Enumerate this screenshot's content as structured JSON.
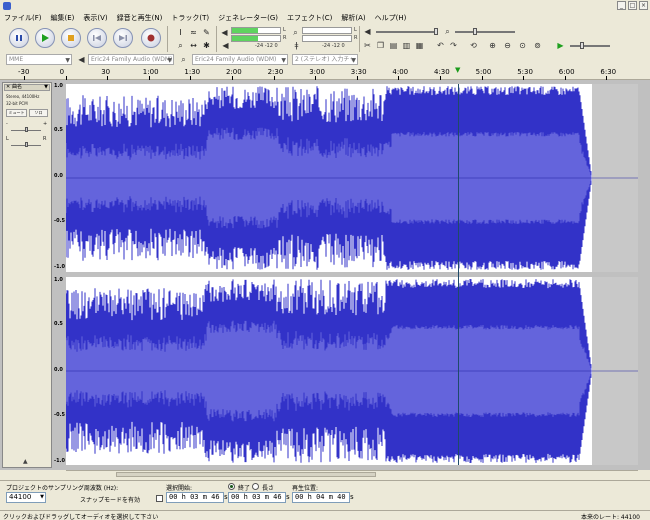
{
  "menubar": [
    "ファイル(F)",
    "編集(E)",
    "表示(V)",
    "録音と再生(N)",
    "トラック(T)",
    "ジェネレーター(G)",
    "エフェクト(C)",
    "解析(A)",
    "ヘルプ(H)"
  ],
  "window": {
    "minimize": "_",
    "maximize": "□",
    "close": "×"
  },
  "transport": [
    "pause-icon",
    "play-icon",
    "stop-icon",
    "skip-start-icon",
    "skip-end-icon",
    "record-icon"
  ],
  "meters": {
    "play_label_l": "L",
    "play_label_r": "R",
    "scale_play": "-24 -12 0",
    "scale_rec": "-24 -12 0",
    "record_label_l": "L",
    "record_label_r": "R",
    "play_level": 0.55
  },
  "devices": {
    "host": "MME",
    "output": "Eric24 Family Audio (WDM)",
    "input": "Eric24 Family Audio (WDM)",
    "channels": "2 (ステレオ) 入力チャ"
  },
  "ruler": {
    "ticks": [
      "-30",
      "0",
      "30",
      "1:00",
      "1:30",
      "2:00",
      "2:30",
      "3:00",
      "3:30",
      "4:00",
      "4:30",
      "5:00",
      "5:30",
      "6:00",
      "6:30"
    ]
  },
  "track": {
    "name": "曲名",
    "info_line1": "Stereo, 44100Hz",
    "info_line2": "32-bit PCM",
    "mute_label": "ミュート",
    "solo_label": "ソロ",
    "gain_minus": "-",
    "gain_plus": "+",
    "pan_left": "L",
    "pan_right": "R",
    "collapse": "▲"
  },
  "scale_labels": {
    "ch1": [
      "1.0",
      "0.5",
      "0.0",
      "-0.5",
      "-1.0"
    ],
    "ch2": [
      "1.0",
      "0.5",
      "0.0",
      "-0.5",
      "-1.0"
    ]
  },
  "selection": {
    "rate_label": "プロジェクトのサンプリング周波数 (Hz):",
    "rate_value": "44100",
    "snap_label": "スナップモードを有効",
    "start_label": "選択開始:",
    "end_label": "終了",
    "length_label": "長さ",
    "position_label": "再生位置:",
    "start_time": "00 h 03 m 46 s",
    "end_time": "00 h 03 m 46 s",
    "position_time": "00 h 04 m 40 s"
  },
  "status": {
    "left": "クリックおよびドラッグしてオーディオを選択して下さい",
    "right": "本来のレート: 44100"
  },
  "colors": {
    "wave": "#3232c8",
    "rms": "#6464dc",
    "playhead": "#1e4a6a"
  }
}
